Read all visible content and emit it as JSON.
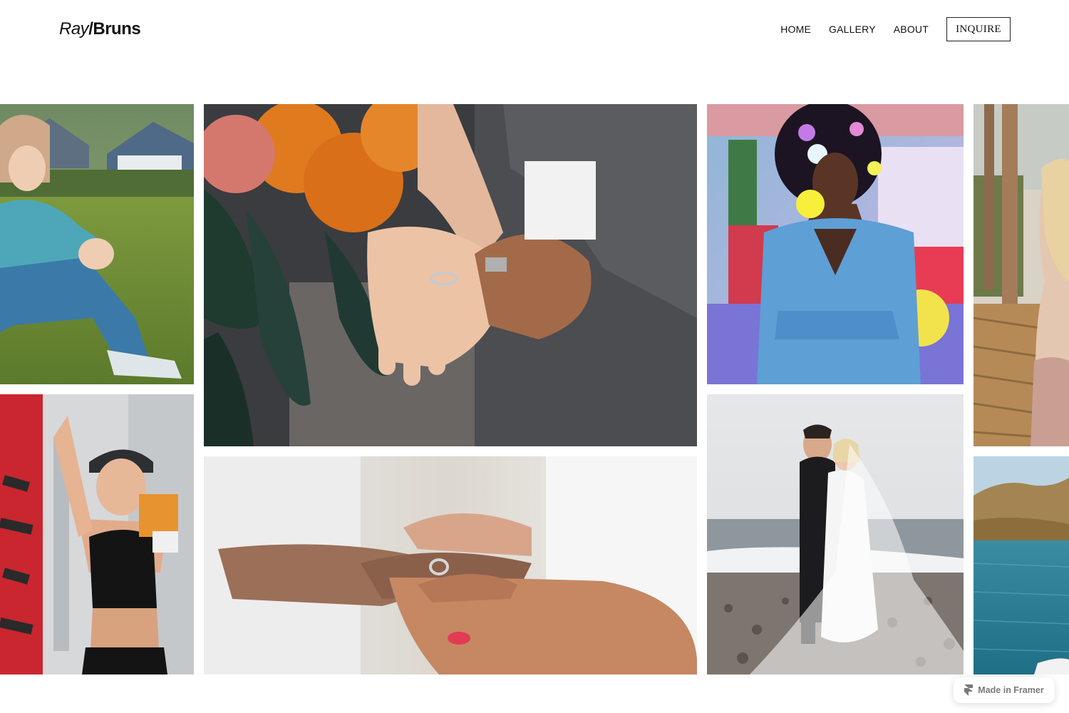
{
  "brand": {
    "first": "Ray",
    "slash": "/",
    "last": "Bruns"
  },
  "nav": {
    "items": [
      {
        "label": "HOME"
      },
      {
        "label": "GALLERY"
      },
      {
        "label": "ABOUT"
      }
    ],
    "cta_label": "INQUIRE"
  },
  "gallery": {
    "photos": [
      {
        "subject": "girl sitting on grass"
      },
      {
        "subject": "hands with wedding rings and bouquet"
      },
      {
        "subject": "woman with flowers in afro hair wearing denim"
      },
      {
        "subject": "woman with blond hair by tree"
      },
      {
        "subject": "woman boxer with punching bag"
      },
      {
        "subject": "hands placing ring on finger"
      },
      {
        "subject": "bride and groom on beach"
      },
      {
        "subject": "lake and hills"
      }
    ]
  },
  "badge": {
    "label": "Made in Framer",
    "icon": "framer-icon"
  }
}
